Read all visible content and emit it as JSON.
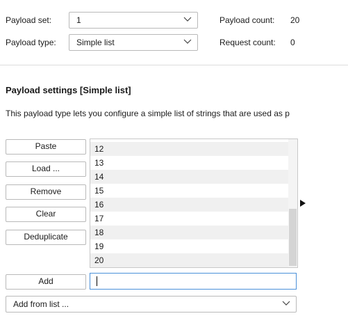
{
  "top": {
    "payload_set_label": "Payload set:",
    "payload_set_value": "1",
    "payload_count_label": "Payload count:",
    "payload_count_value": "20",
    "payload_type_label": "Payload type:",
    "payload_type_value": "Simple list",
    "request_count_label": "Request count:",
    "request_count_value": "0"
  },
  "settings": {
    "heading": "Payload settings [Simple list]",
    "description": "This payload type lets you configure a simple list of strings that are used as p",
    "buttons": {
      "paste": "Paste",
      "load": "Load ...",
      "remove": "Remove",
      "clear": "Clear",
      "deduplicate": "Deduplicate",
      "add": "Add"
    },
    "list_items": [
      "12",
      "13",
      "14",
      "15",
      "16",
      "17",
      "18",
      "19",
      "20"
    ],
    "add_input_value": "",
    "add_from_list": "Add from list ..."
  },
  "icons": {
    "chevron": "chevron-down-icon",
    "expand": "triangle-right-icon"
  }
}
